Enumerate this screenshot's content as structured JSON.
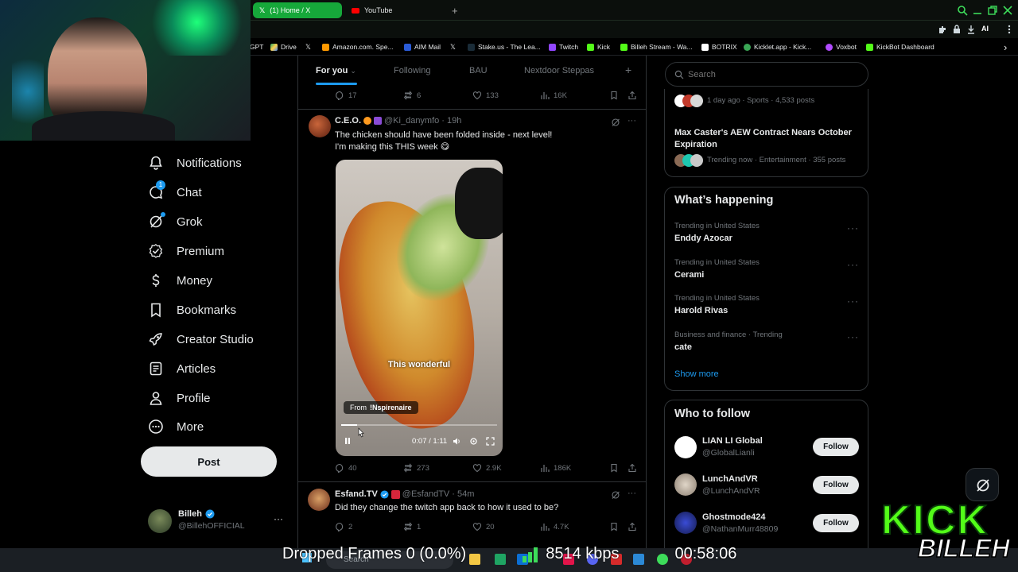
{
  "browser": {
    "tabs": [
      {
        "label": "(1) Home / X",
        "active": true
      },
      {
        "label": "YouTube",
        "active": false
      }
    ],
    "new_tab_glyph": "+",
    "ai_label": "AI",
    "bookmarks": [
      {
        "label": "GPT"
      },
      {
        "label": "Drive"
      },
      {
        "label": "Amazon.com. Spe..."
      },
      {
        "label": "AIM Mail"
      },
      {
        "label": "Stake.us - The Lea..."
      },
      {
        "label": "Twitch"
      },
      {
        "label": "Kick"
      },
      {
        "label": "Billeh Stream - Wa..."
      },
      {
        "label": "BOTRIX"
      },
      {
        "label": "Kicklet.app - Kick..."
      },
      {
        "label": "Voxbot"
      },
      {
        "label": "KickBot Dashboard"
      }
    ],
    "more_glyph": "›"
  },
  "nav": {
    "items": [
      {
        "label": "Notifications",
        "icon": "bell-icon"
      },
      {
        "label": "Chat",
        "icon": "chat-icon",
        "badge": "1"
      },
      {
        "label": "Grok",
        "icon": "grok-icon"
      },
      {
        "label": "Premium",
        "icon": "premium-icon"
      },
      {
        "label": "Money",
        "icon": "money-icon"
      },
      {
        "label": "Bookmarks",
        "icon": "bookmark-icon"
      },
      {
        "label": "Creator Studio",
        "icon": "rocket-icon"
      },
      {
        "label": "Articles",
        "icon": "articles-icon"
      },
      {
        "label": "Profile",
        "icon": "person-icon"
      },
      {
        "label": "More",
        "icon": "more-circle-icon"
      }
    ],
    "post_label": "Post",
    "account": {
      "name": "Billeh",
      "handle": "@BillehOFFICIAL",
      "more": "···"
    }
  },
  "feed": {
    "tabs": [
      "For you",
      "Following",
      "BAU",
      "Nextdoor Steppas"
    ],
    "add_tab": "+",
    "top_actions": {
      "replies": "17",
      "reposts": "6",
      "likes": "133",
      "views": "16K"
    },
    "post1": {
      "name": "C.E.O.",
      "handle": "@Ki_danymfo",
      "time": "· 19h",
      "line1": "The chicken should have been folded inside - next level!",
      "line2": "I'm making this THIS week 😋",
      "video": {
        "caption": "This wonderful",
        "from_label": "From",
        "source": "!Nspirenaire",
        "time": "0:07 / 1:11",
        "progress": 0.1
      },
      "actions": {
        "replies": "40",
        "reposts": "273",
        "likes": "2.9K",
        "views": "186K"
      }
    },
    "post2": {
      "name": "Esfand.TV",
      "handle": "@EsfandTV",
      "time": "· 54m",
      "text": "Did they change the twitch app back to how it used to be?",
      "actions": {
        "replies": "2",
        "reposts": "1",
        "likes": "20",
        "views": "4.7K"
      }
    }
  },
  "right": {
    "search_placeholder": "Search",
    "top_trend": {
      "meta": "1 day ago · Sports · 4,533 posts"
    },
    "news": {
      "title": "Max Caster's AEW Contract Nears October Expiration",
      "meta": "Trending now · Entertainment · 355 posts"
    },
    "whats_happening": {
      "title": "What’s happening",
      "trends": [
        {
          "meta": "Trending in United States",
          "title": "Enddy Azocar"
        },
        {
          "meta": "Trending in United States",
          "title": "Cerami"
        },
        {
          "meta": "Trending in United States",
          "title": "Harold Rivas"
        },
        {
          "meta": "Business and finance · Trending",
          "title": "cate"
        }
      ],
      "show_more": "Show more",
      "dots": "···"
    },
    "who_to_follow": {
      "title": "Who to follow",
      "follow_label": "Follow",
      "accounts": [
        {
          "name": "LIAN LI Global",
          "handle": "@GlobalLianli"
        },
        {
          "name": "LunchAndVR",
          "handle": "@LunchAndVR"
        },
        {
          "name": "Ghostmode424",
          "handle": "@NathanMurr48809"
        }
      ]
    }
  },
  "overlay": {
    "dropped_frames": "Dropped Frames 0 (0.0%)",
    "bitrate": "8514 kbps",
    "elapsed": "00:58:06",
    "kick_logo": "KICK",
    "billeh_logo": "BILLEH",
    "search": "Search"
  },
  "colors": {
    "accent": "#1d9bf0",
    "kick_green": "#53fc18",
    "tab_green": "#16a83a"
  }
}
